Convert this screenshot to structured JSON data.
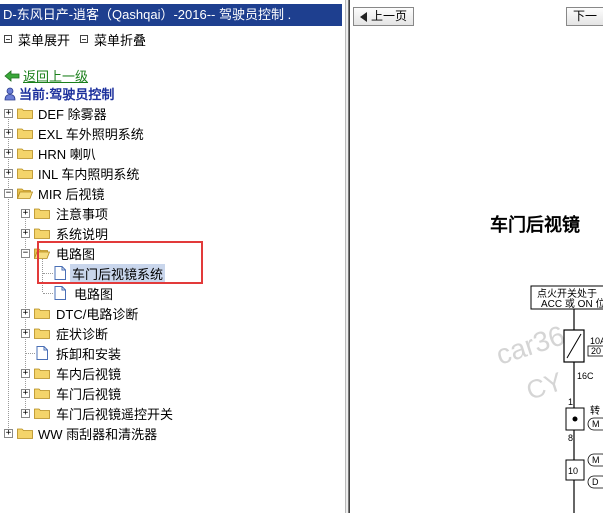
{
  "window": {
    "title": "D-东风日产-逍客（Qashqai）-2016-- 驾驶员控制 ."
  },
  "menu": {
    "expand": "菜单展开",
    "collapse": "菜单折叠"
  },
  "nav": {
    "back": "返回上一级",
    "current": "当前:驾驶员控制"
  },
  "tree": {
    "items": [
      {
        "label": "DEF 除雾器"
      },
      {
        "label": "EXL 车外照明系统"
      },
      {
        "label": "HRN 喇叭"
      },
      {
        "label": "INL 车内照明系统"
      },
      {
        "label": "MIR 后视镜"
      },
      {
        "label": "注意事项"
      },
      {
        "label": "系统说明"
      },
      {
        "label": "电路图"
      },
      {
        "label": "车门后视镜系统"
      },
      {
        "label": "电路图"
      },
      {
        "label": "DTC/电路诊断"
      },
      {
        "label": "症状诊断"
      },
      {
        "label": "拆卸和安装"
      },
      {
        "label": "车内后视镜"
      },
      {
        "label": "车门后视镜"
      },
      {
        "label": "车门后视镜遥控开关"
      },
      {
        "label": "WW 雨刮器和清洗器"
      }
    ]
  },
  "viewer": {
    "prev": "上一页",
    "next": "下一",
    "title": "车门后视镜",
    "diagram": {
      "box1_line1": "点火开关处于",
      "box1_line2": "ACC 或 ON 位",
      "fuse_line1": "10A",
      "fuse_line2": "20",
      "label_16c": "16C",
      "pin1": "1",
      "pin8": "8",
      "pin10": "10",
      "side_label": "转",
      "tag_a": "M",
      "tag_b": "M",
      "tag_c": "D",
      "watermark1": "car36",
      "watermark2": "CY"
    }
  }
}
